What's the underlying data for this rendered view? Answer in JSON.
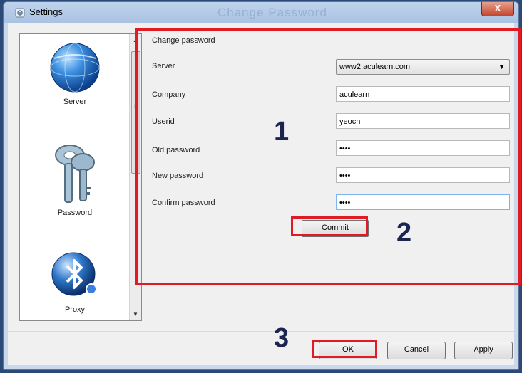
{
  "window": {
    "title": "Settings",
    "watermark": "Change Password",
    "close_glyph": "X"
  },
  "sidebar": {
    "items": [
      {
        "label": "Server",
        "icon": "globe-icon"
      },
      {
        "label": "Password",
        "icon": "keys-icon"
      },
      {
        "label": "Proxy",
        "icon": "bluetooth-icon"
      }
    ],
    "scroll_up": "▲",
    "scroll_down": "▼"
  },
  "change_password": {
    "group_title": "Change password",
    "server": {
      "label": "Server",
      "value": "www2.aculearn.com"
    },
    "company": {
      "label": "Company",
      "value": "aculearn"
    },
    "userid": {
      "label": "Userid",
      "value": "yeoch"
    },
    "old_password": {
      "label": "Old password",
      "value": "••••"
    },
    "new_password": {
      "label": "New password",
      "value": "••••"
    },
    "confirm_password": {
      "label": "Confirm password",
      "value": "••••"
    },
    "commit_label": "Commit"
  },
  "footer": {
    "ok_label": "OK",
    "cancel_label": "Cancel",
    "apply_label": "Apply"
  },
  "callouts": {
    "one": "1",
    "two": "2",
    "three": "3",
    "color": "#e01b24"
  }
}
